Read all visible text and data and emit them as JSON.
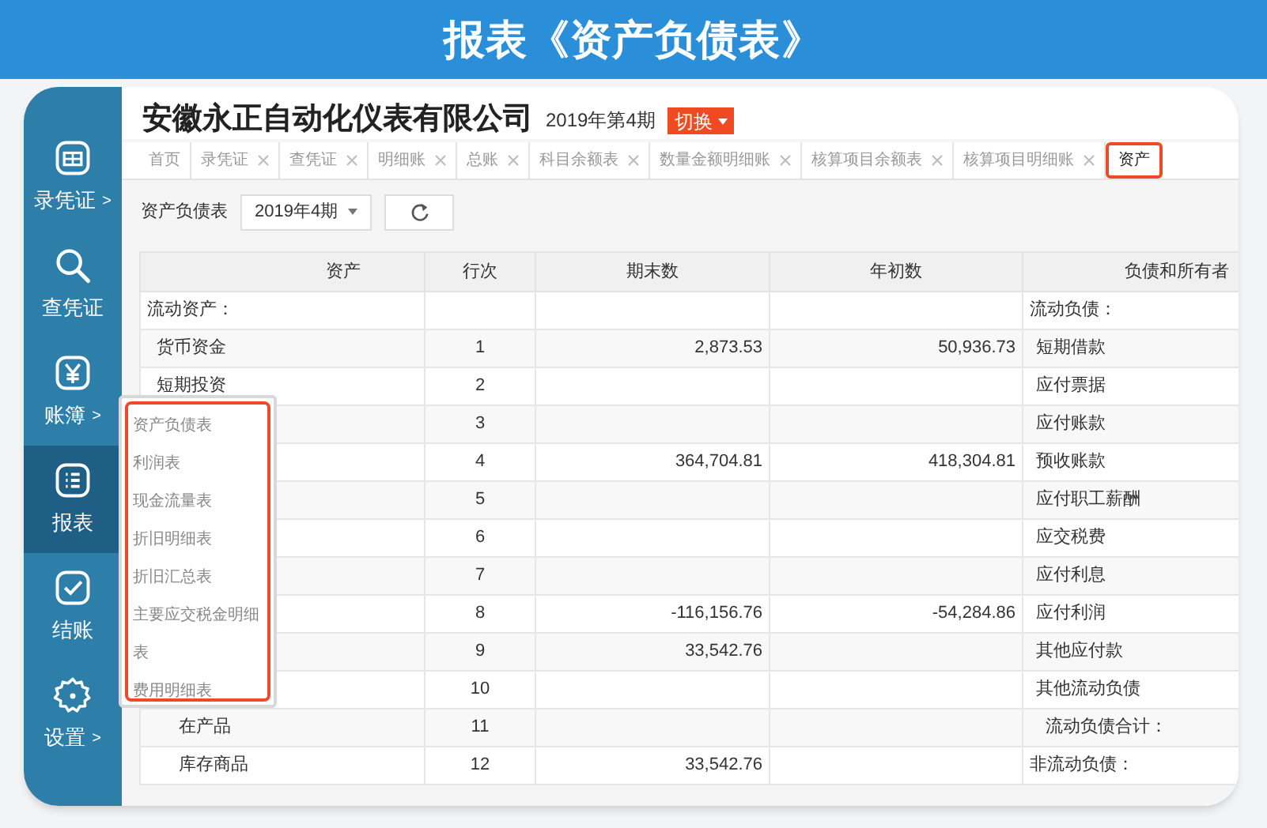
{
  "banner": {
    "title": "报表《资产负债表》"
  },
  "header": {
    "company": "安徽永正自动化仪表有限公司",
    "period": "2019年第4期",
    "switch_button": "切换"
  },
  "sidebar": {
    "items": [
      {
        "label": "录凭证",
        "arrow": ">",
        "kind": "voucher",
        "selected": false
      },
      {
        "label": "查凭证",
        "kind": "search",
        "selected": false
      },
      {
        "label": "账簿",
        "arrow": ">",
        "kind": "ledger",
        "selected": false
      },
      {
        "label": "报表",
        "kind": "report",
        "selected": true
      },
      {
        "label": "结账",
        "kind": "check",
        "selected": false
      },
      {
        "label": "设置",
        "arrow": ">",
        "kind": "gear",
        "selected": false
      }
    ]
  },
  "tabs": [
    {
      "label": "首页",
      "closable": false,
      "selected": false
    },
    {
      "label": "录凭证",
      "closable": true,
      "selected": false
    },
    {
      "label": "查凭证",
      "closable": true,
      "selected": false
    },
    {
      "label": "明细账",
      "closable": true,
      "selected": false
    },
    {
      "label": "总账",
      "closable": true,
      "selected": false
    },
    {
      "label": "科目余额表",
      "closable": true,
      "selected": false
    },
    {
      "label": "数量金额明细账",
      "closable": true,
      "selected": false
    },
    {
      "label": "核算项目余额表",
      "closable": true,
      "selected": false
    },
    {
      "label": "核算项目明细账",
      "closable": true,
      "selected": false
    },
    {
      "label": "资产",
      "closable": false,
      "selected": true
    }
  ],
  "toolbar": {
    "label": "资产负债表",
    "period_select": "2019年4期"
  },
  "report_menu": {
    "items": [
      "资产负债表",
      "利润表",
      "现金流量表",
      "折旧明细表",
      "折旧汇总表",
      "主要应交税金明细表",
      "费用明细表"
    ]
  },
  "table": {
    "columns": [
      "资产",
      "行次",
      "期末数",
      "年初数",
      "负债和所有者"
    ],
    "rows": [
      {
        "asset": "流动资产：",
        "line": "",
        "end": "",
        "begin": "",
        "liability": "流动负债："
      },
      {
        "asset": "货币资金",
        "line": "1",
        "end": "2,873.53",
        "begin": "50,936.73",
        "liability": "短期借款"
      },
      {
        "asset": "短期投资",
        "line": "2",
        "end": "",
        "begin": "",
        "liability": "应付票据"
      },
      {
        "asset": "",
        "line": "3",
        "end": "",
        "begin": "",
        "liability": "应付账款"
      },
      {
        "asset": "",
        "line": "4",
        "end": "364,704.81",
        "begin": "418,304.81",
        "liability": "预收账款"
      },
      {
        "asset": "",
        "line": "5",
        "end": "",
        "begin": "",
        "liability": "应付职工薪酬"
      },
      {
        "asset": "",
        "line": "6",
        "end": "",
        "begin": "",
        "liability": "应交税费"
      },
      {
        "asset": "",
        "line": "7",
        "end": "",
        "begin": "",
        "liability": "应付利息"
      },
      {
        "asset": "",
        "line": "8",
        "end": "-116,156.76",
        "begin": "-54,284.86",
        "liability": "应付利润"
      },
      {
        "asset": "",
        "line": "9",
        "end": "33,542.76",
        "begin": "",
        "liability": "其他应付款"
      },
      {
        "asset": "",
        "line": "10",
        "end": "",
        "begin": "",
        "liability": "其他流动负债"
      },
      {
        "asset": "在产品",
        "line": "11",
        "end": "",
        "begin": "",
        "liability": "流动负债合计："
      },
      {
        "asset": "库存商品",
        "line": "12",
        "end": "33,542.76",
        "begin": "",
        "liability": "非流动负债："
      }
    ]
  }
}
